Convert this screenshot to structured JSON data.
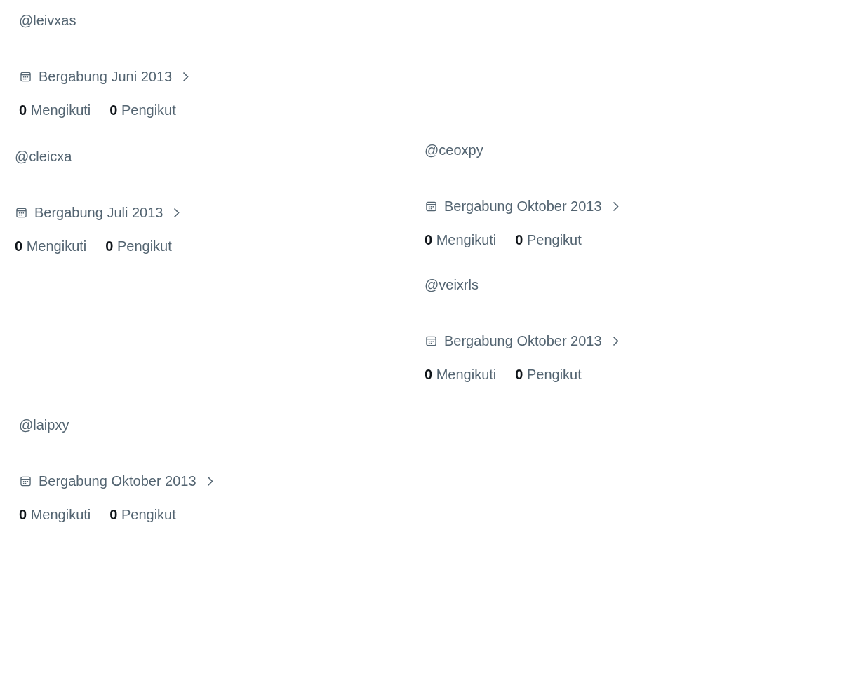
{
  "columns": [
    {
      "profiles": [
        {
          "handle": "@leivxas",
          "joined": "Bergabung Juni 2013",
          "following": "**0** Mengikuti",
          "followers": "**0** Pengikut"
        },
        {
          "handle": "@cleicxa",
          "joined": "Bergabung Juli 2013",
          "following": "**0** Mengikuti",
          "followers": "**0** Pengikut"
        },
        {
          "handle": "@laipxy",
          "joined": "Bergabung Oktober 2013",
          "following": "**0** Mengikuti",
          "followers": "**0** Pengikut"
        }
      ]
    },
    {
      "profiles": [
        {
          "handle": "@ceoxpy",
          "joined": "Bergabung Oktober 2013",
          "following": "**0** Mengikuti",
          "followers": "**0** Pengikut"
        },
        {
          "handle": "@veixrls",
          "joined": "Bergabung Oktober 2013",
          "following": "**0** Mengikuti",
          "followers": "**0** Pengikut"
        }
      ]
    }
  ]
}
